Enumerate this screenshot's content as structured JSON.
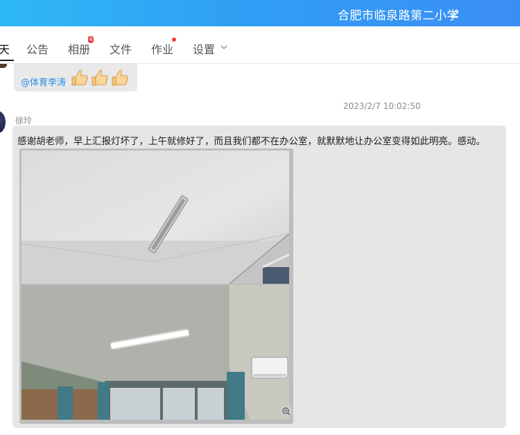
{
  "header": {
    "group_name": "合肥市临泉路第二小学",
    "edit_icon": "pencil-icon",
    "bg_color": "#2fa6f5"
  },
  "tabs": [
    {
      "label": "天",
      "active": true
    },
    {
      "label": "公告"
    },
    {
      "label": "相册",
      "badge": "4"
    },
    {
      "label": "文件"
    },
    {
      "label": "作业",
      "dot": true
    },
    {
      "label": "设置",
      "icon": "chevron-down-icon"
    }
  ],
  "reply": {
    "mention": "@体育李涛",
    "emoji": [
      "thumbs-up-icon",
      "thumbs-up-icon",
      "thumbs-up-icon"
    ]
  },
  "message": {
    "timestamp": "2023/2/7 10:02:50",
    "sender": "徐玲",
    "text": "感谢胡老师，早上汇报灯坏了，上午就修好了，而且我们都不在办公室，就默默地让办公室变得如此明亮。感动。",
    "image_icon": "zoom-in-icon"
  }
}
